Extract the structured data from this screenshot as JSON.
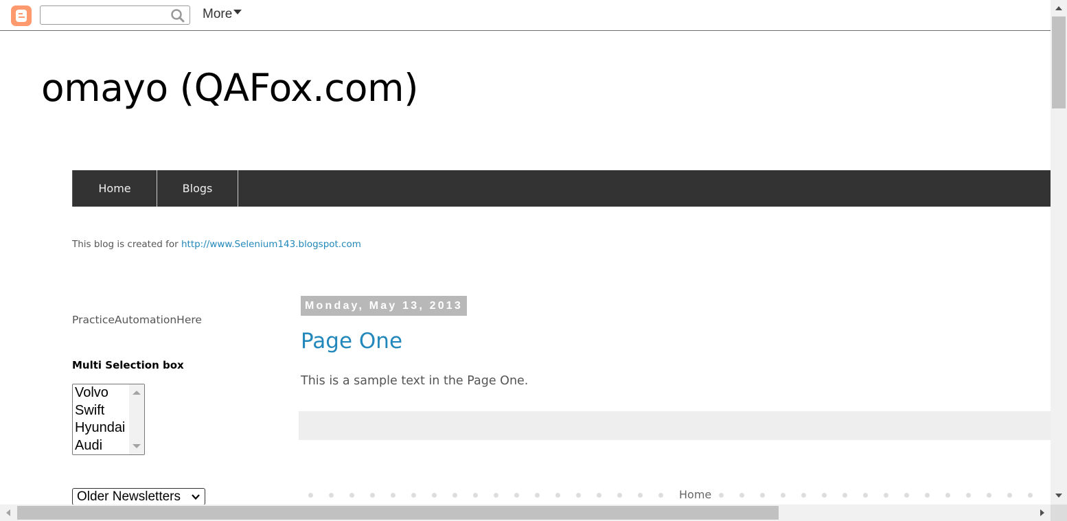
{
  "navbar": {
    "logo_icon": "blogger-logo-icon",
    "search_placeholder": "",
    "search_icon": "search-icon",
    "more_label": "More"
  },
  "header": {
    "site_title": "omayo (QAFox.com)"
  },
  "tabs": [
    {
      "label": "Home"
    },
    {
      "label": "Blogs"
    }
  ],
  "description": {
    "text": "This blog is created for ",
    "link_text": "http://www.Selenium143.blogspot.com"
  },
  "sidebar": {
    "heading": "PracticeAutomationHere",
    "multiselect_label": "Multi Selection box",
    "multiselect_options": [
      "Volvo",
      "Swift",
      "Hyundai",
      "Audi"
    ],
    "dropdown_selected": "Older Newsletters"
  },
  "post": {
    "date": "Monday, May 13, 2013",
    "title": "Page One",
    "body": "This is a sample text in the Page One."
  },
  "pager": {
    "home_label": "Home"
  },
  "colors": {
    "tab_bar_bg": "#333333",
    "link": "#2288bb",
    "date_header_bg": "#b8b8b8",
    "blogger_orange": "#ff9a6e"
  }
}
